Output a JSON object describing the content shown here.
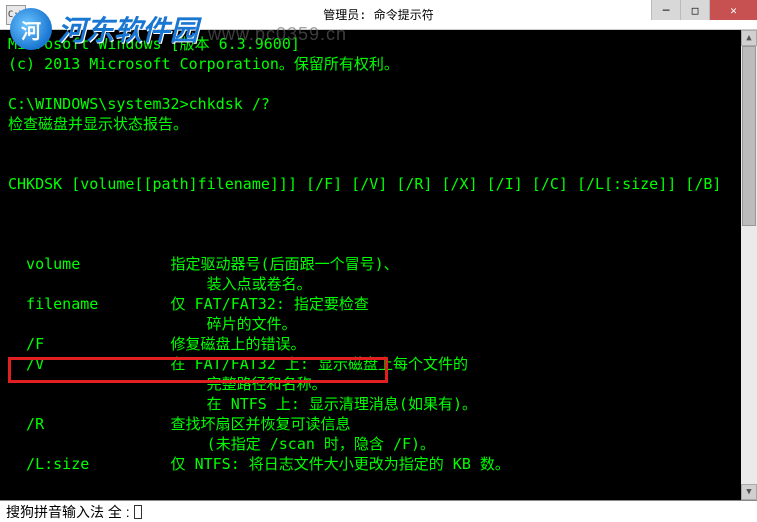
{
  "titlebar": {
    "icon_label": "C:\\",
    "title": "管理员: 命令提示符"
  },
  "win_controls": {
    "min": "─",
    "max": "□",
    "close": "✕"
  },
  "watermark": {
    "logo_text": "河",
    "text": "河东软件园",
    "url": "www.pc0359.cn"
  },
  "terminal": {
    "line1": "Microsoft Windows [版本 6.3.9600]",
    "line2": "(c) 2013 Microsoft Corporation。保留所有权利。",
    "line3": "",
    "line4": "C:\\WINDOWS\\system32>chkdsk /?",
    "line5": "检查磁盘并显示状态报告。",
    "line6": "",
    "line7": "",
    "line8": "CHKDSK [volume[[path]filename]]] [/F] [/V] [/R] [/X] [/I] [/C] [/L[:size]] [/B]",
    "line9": "",
    "line10": "",
    "line11": "",
    "line12": "  volume          指定驱动器号(后面跟一个冒号)、",
    "line13": "                      装入点或卷名。",
    "line14": "  filename        仅 FAT/FAT32: 指定要检查",
    "line15": "                      碎片的文件。",
    "line16": "  /F              修复磁盘上的错误。",
    "line17": "  /V              在 FAT/FAT32 上: 显示磁盘上每个文件的",
    "line18": "                      完整路径和名称。",
    "line19": "                      在 NTFS 上: 显示清理消息(如果有)。",
    "line20": "  /R              查找坏扇区并恢复可读信息",
    "line21": "                      (未指定 /scan 时，隐含 /F)。",
    "line22": "  /L:size         仅 NTFS: 将日志文件大小更改为指定的 KB 数。"
  },
  "statusbar": {
    "ime": "搜狗拼音输入法 全 :"
  },
  "scroll": {
    "up": "▲",
    "down": "▼"
  }
}
